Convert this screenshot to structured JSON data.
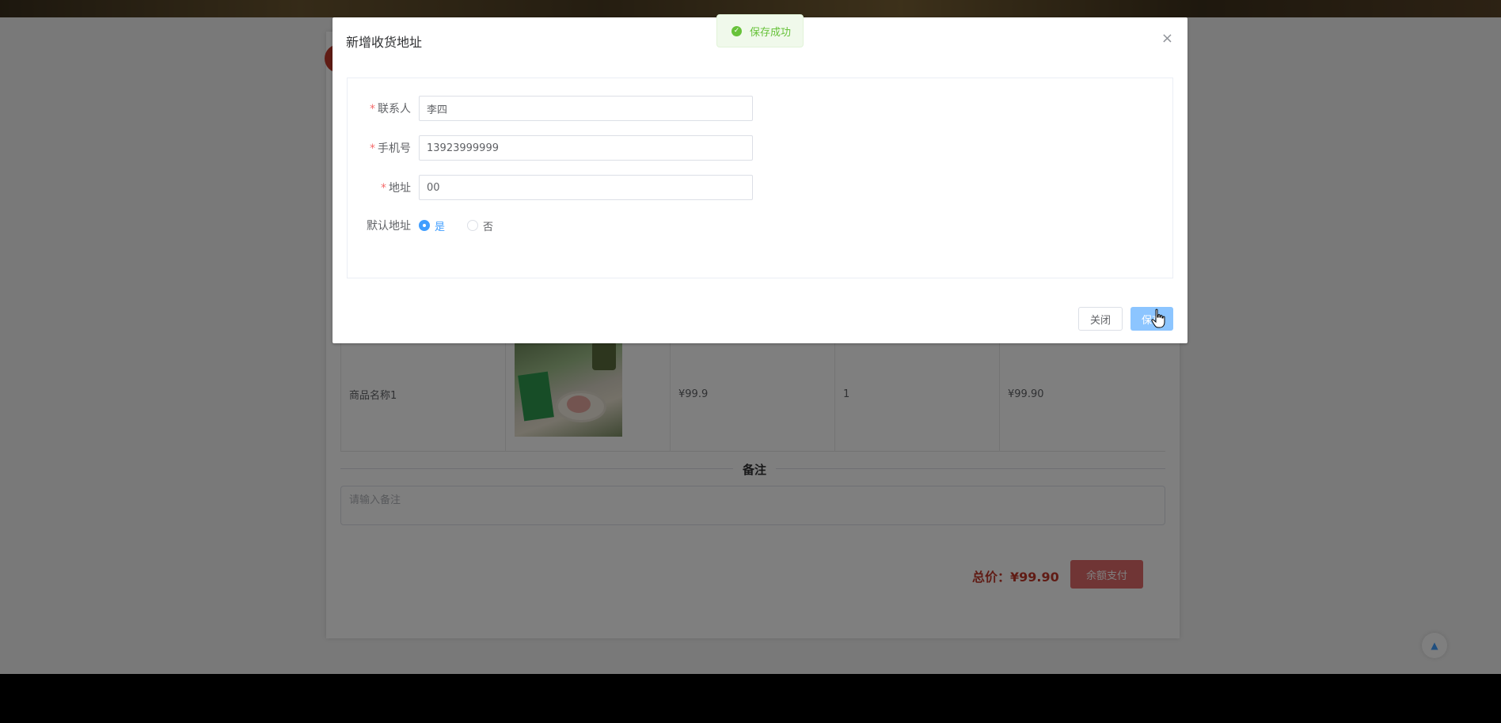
{
  "background": {
    "goods_row": {
      "name": "商品名称1",
      "price": "¥99.9",
      "quantity": "1",
      "subtotal": "¥99.90"
    },
    "remark_title": "备注",
    "remark_placeholder": "请输入备注",
    "total_label": "总价：¥99.90",
    "pay_button": "余额支付",
    "backtop_icon": "▲"
  },
  "dialog": {
    "title": "新增收货地址",
    "close_icon": "×",
    "fields": {
      "contact": {
        "label": "联系人",
        "value": "李四"
      },
      "phone": {
        "label": "手机号",
        "value": "13923999999"
      },
      "address": {
        "label": "地址",
        "value": "00"
      }
    },
    "default_address": {
      "label": "默认地址",
      "options": [
        "是",
        "否"
      ],
      "selected": "是"
    },
    "buttons": {
      "close": "关闭",
      "save": "保存"
    }
  },
  "toast": {
    "icon": "✓",
    "message": "保存成功"
  },
  "colors": {
    "primary": "#409eff",
    "success": "#67c23a",
    "danger": "#c0392b"
  }
}
